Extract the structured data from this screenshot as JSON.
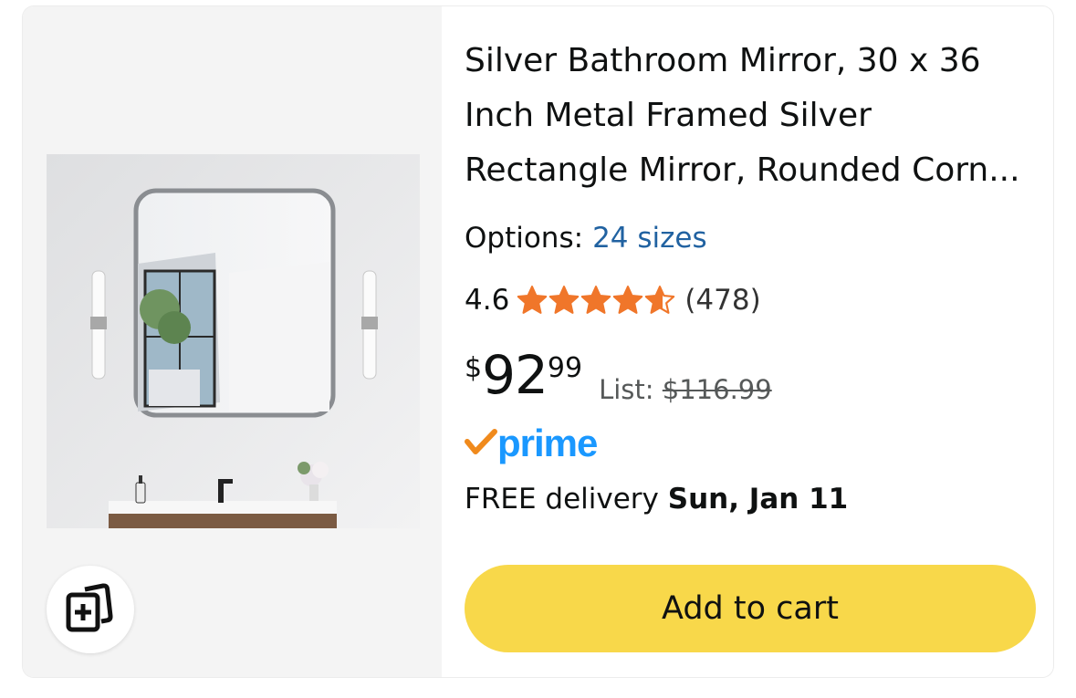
{
  "product": {
    "title": "Silver Bathroom Mirror, 30 x 36 Inch Metal Framed Silver Rectangle Mirror, Rounded Corn...",
    "options_label": "Options:",
    "options_link": "24 sizes",
    "rating_value": "4.6",
    "rating_stars": 4.6,
    "rating_count": "(478)",
    "price_symbol": "$",
    "price_whole": "92",
    "price_fraction": "99",
    "list_label": "List:",
    "list_price": "$116.99",
    "prime_label": "prime",
    "delivery_prefix": "FREE delivery",
    "delivery_date": "Sun, Jan 11",
    "add_to_cart_label": "Add to cart"
  },
  "icons": {
    "compare": "compare-cards-icon",
    "star": "star-icon",
    "prime_check": "prime-check-icon"
  },
  "colors": {
    "accent_link": "#2162a1",
    "star": "#f0762a",
    "prime": "#1a98ff",
    "prime_check": "#f08a1c",
    "cart_button": "#f8d84a"
  }
}
